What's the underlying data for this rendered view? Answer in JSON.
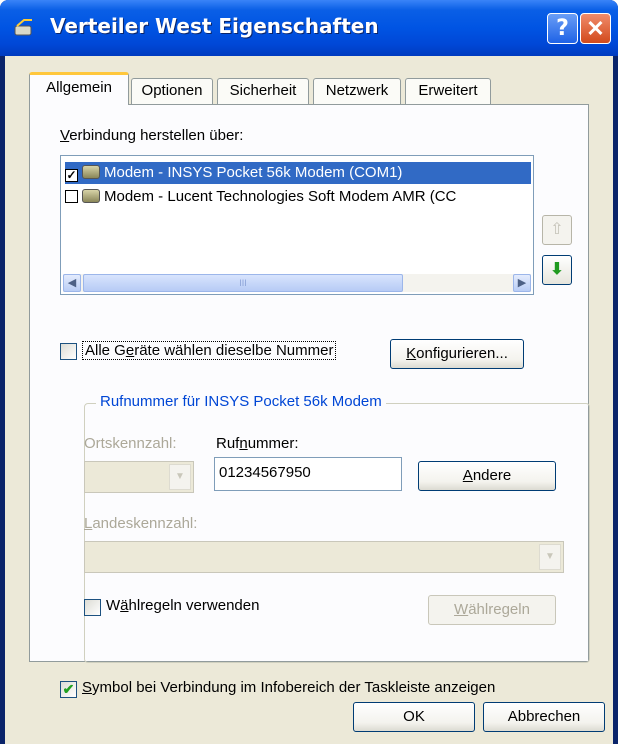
{
  "window": {
    "title": "Verteiler West Eigenschaften",
    "help_glyph": "?",
    "close_glyph": "✕"
  },
  "tabs": [
    {
      "label": "Allgemein",
      "active": true
    },
    {
      "label": "Optionen"
    },
    {
      "label": "Sicherheit"
    },
    {
      "label": "Netzwerk"
    },
    {
      "label": "Erweitert"
    }
  ],
  "connect": {
    "label_first": "V",
    "label_rest": "erbindung herstellen über:",
    "devices": [
      {
        "label": "Modem - INSYS Pocket 56k Modem (COM1)",
        "checked": true,
        "selected": true
      },
      {
        "label": "Modem - Lucent Technologies Soft Modem AMR (CC",
        "checked": false,
        "selected": false
      }
    ],
    "scroll_left": "◀",
    "scroll_right": "▶",
    "scroll_grip": "III",
    "move_up": "⇧",
    "move_down": "⬇"
  },
  "same_number": {
    "pre": "Alle G",
    "acc": "e",
    "post": "räte wählen dieselbe Nummer",
    "checked": false
  },
  "configure_button": {
    "acc": "K",
    "rest": "onfigurieren..."
  },
  "phone_group": {
    "title": "Rufnummer für INSYS Pocket 56k Modem",
    "area_code": {
      "pre": "Ortskennzahl:",
      "value": ""
    },
    "phone": {
      "pre": "Ruf",
      "acc": "n",
      "post": "ummer:",
      "value": "01234567950"
    },
    "other_button": {
      "acc": "A",
      "rest": "ndere"
    },
    "country": {
      "acc": "L",
      "rest": "andeskennzahl:",
      "value": ""
    },
    "dialing_rules": {
      "pre": "W",
      "acc": "ä",
      "post": "hlregeln verwenden",
      "checked": false
    },
    "dialing_rules_button": {
      "acc": "W",
      "rest": "ählregeln"
    }
  },
  "show_icon": {
    "acc": "S",
    "rest": "ymbol bei Verbindung im Infobereich der Taskleiste anzeigen",
    "checked": true,
    "check_glyph": "✔"
  },
  "footer": {
    "ok": "OK",
    "cancel": "Abbrechen"
  },
  "colors": {
    "titlebar": "#0054e3",
    "selection": "#316ac5",
    "group_title": "#0046d5",
    "dialog_bg": "#ece9d8"
  }
}
